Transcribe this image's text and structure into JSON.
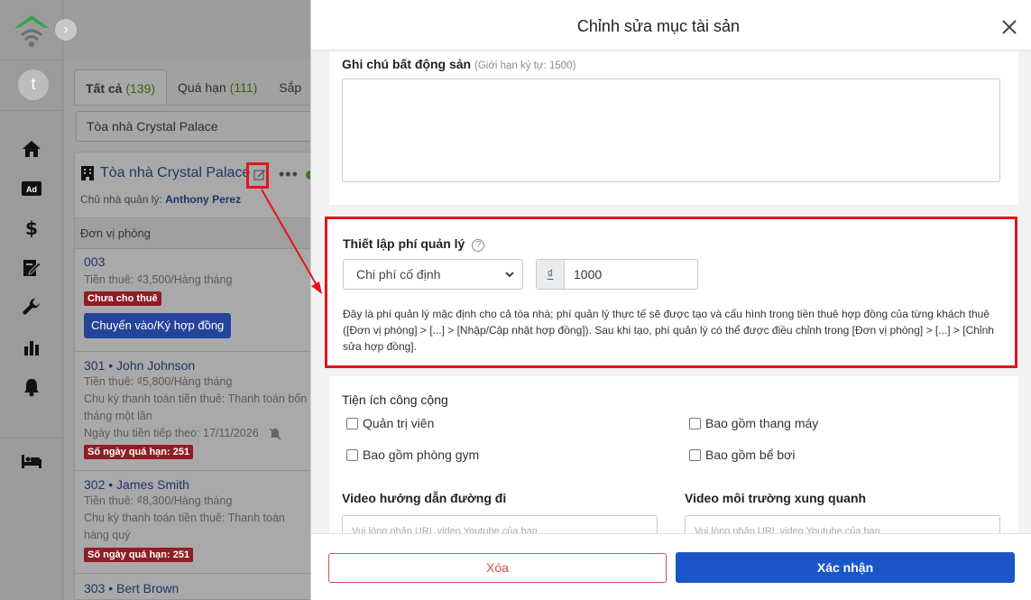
{
  "nav": {
    "avatar_letter": "t",
    "items": [
      "home-icon",
      "ad-icon",
      "dollar-icon",
      "contract-icon",
      "wrench-icon",
      "chart-icon",
      "bell-icon",
      "bed-icon"
    ],
    "ad_label": "Ad",
    "collapse_glyph": "›"
  },
  "list": {
    "tabs": [
      {
        "label": "Tất cả",
        "count": "(139)"
      },
      {
        "label": "Quá hạn",
        "count": "(111)"
      },
      {
        "label": "Sắp",
        "count": ""
      }
    ],
    "search_value": "Tòa nhà Crystal Palace",
    "building": {
      "name": "Tòa nhà Crystal Palace",
      "owner_label": "Chủ nhà quản lý:",
      "owner_name": "Anthony Perez",
      "more_glyph": "•••"
    },
    "section_label": "Đơn vị phòng",
    "units": [
      {
        "name": "003",
        "rent": "Tiền thuê: ₫3,500/Hàng tháng",
        "badge": "Chưa cho thuê",
        "button": "Chuyển vào/Ký hợp đồng"
      },
      {
        "name": "301 • John Johnson",
        "rent": "Tiền thuê: ₫5,800/Hàng tháng",
        "cycle": "Chu kỳ thanh toán tiền thuê: Thanh toán bốn tháng một lần",
        "next": "Ngày thu tiền tiếp theo:  17/11/2026",
        "badge": "Số ngày quá hạn: 251"
      },
      {
        "name": "302 • James Smith",
        "rent": "Tiền thuê: ₫8,300/Hàng tháng",
        "cycle": "Chu kỳ thanh toán tiền thuê: Thanh toán hàng quý",
        "badge": "Số ngày quá hạn: 251"
      },
      {
        "name": "303 • Bert Brown"
      }
    ]
  },
  "modal": {
    "title": "Chỉnh sửa mục tài sản",
    "notes_label": "Ghi chú bất động sản",
    "notes_hint": "(Giới hạn ký tự: 1500)",
    "notes_value": "",
    "fee": {
      "label": "Thiết lập phí quản lý",
      "help_glyph": "?",
      "type_selected": "Chi phí cố định",
      "currency": "₫",
      "amount": "1000",
      "description": "Đây là phí quản lý mặc định cho cả tòa nhà; phí quản lý thực tế sẽ được tạo và cấu hình trong tiền thuê hợp đồng của từng khách thuê ([Đơn vị phòng] > [...] > [Nhập/Cập nhật hợp đồng]). Sau khi tạo, phí quản lý có thể được điều chỉnh trong [Đơn vị phòng] > [...] > [Chỉnh sửa hợp đồng]."
    },
    "amenities": {
      "label": "Tiện ích công cộng",
      "items": [
        "Quản trị viên",
        "Bao gồm thang máy",
        "Bao gồm phòng gym",
        "Bao gồm bể bơi"
      ]
    },
    "video_directions": {
      "label": "Video hướng dẫn đường đi",
      "placeholder": "Vui lòng nhập URL video Youtube của bạn"
    },
    "video_surroundings": {
      "label": "Video môi trường xung quanh",
      "placeholder": "Vui lòng nhập URL video Youtube của bạn"
    },
    "delete_label": "Xóa",
    "confirm_label": "Xác nhận"
  },
  "colors": {
    "accent": "#1b56c8",
    "highlight": "#e0141e",
    "danger": "#d84a53",
    "logo_green": "#3aa34a"
  }
}
